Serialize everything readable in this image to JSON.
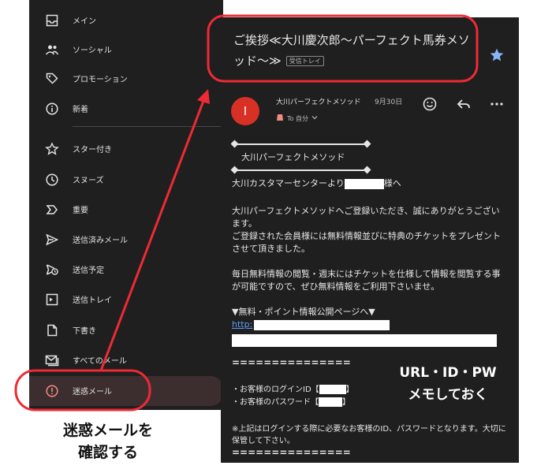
{
  "sidebar": {
    "items": [
      {
        "label": "メイン",
        "icon": "inbox-icon"
      },
      {
        "label": "ソーシャル",
        "icon": "people-icon"
      },
      {
        "label": "プロモーション",
        "icon": "tag-icon"
      },
      {
        "label": "新着",
        "icon": "info-icon"
      },
      {
        "label": "スター付き",
        "icon": "star-icon"
      },
      {
        "label": "スヌーズ",
        "icon": "clock-icon"
      },
      {
        "label": "重要",
        "icon": "important-icon"
      },
      {
        "label": "送信済みメール",
        "icon": "send-icon"
      },
      {
        "label": "送信予定",
        "icon": "schedule-send-icon"
      },
      {
        "label": "送信トレイ",
        "icon": "outbox-icon"
      },
      {
        "label": "下書き",
        "icon": "draft-icon"
      },
      {
        "label": "すべてのメール",
        "icon": "all-mail-icon"
      },
      {
        "label": "迷惑メール",
        "icon": "spam-icon",
        "active": true
      }
    ]
  },
  "email": {
    "subject": "ご挨拶≪大川慶次郎〜パーフェクト馬券メソッド〜≫",
    "label_badge": "受信トレイ",
    "avatar_letter": "I",
    "sender": "大川パーフェクトメソッド",
    "date": "9月30日",
    "to_line": "To 自分",
    "header_title": "大川パーフェクトメソッド",
    "greeting_prefix": "大川カスタマーセンターより",
    "greeting_suffix": "様へ",
    "para1": "大川パーフェクトメソッドへご登録いただき、誠にありがとうございます。\nご登録された会員様には無料情報並びに特典のチケットをプレゼントさせて頂きました。",
    "para2": "毎日無料情報の閲覧・週末にはチケットを仕様して情報を閲覧する事が可能ですので、ぜひ無料情報をご利用下さいませ。",
    "page_heading": "▼無料・ポイント情報公開ページへ▼",
    "link_prefix": "http:",
    "separator": "===============",
    "login_id_label": "・お客様のログインID【",
    "password_label": "・お客様のパスワード【",
    "bracket_close": "】",
    "note": "※上記はログインする際に必要なお客様のID、パスワードとなります。大切に保管して下さい。"
  },
  "annotations": {
    "callout": "URL・ID・PW\nメモしておく",
    "caption": "迷惑メールを\n確認する",
    "highlight_color": "#ee2a35"
  }
}
